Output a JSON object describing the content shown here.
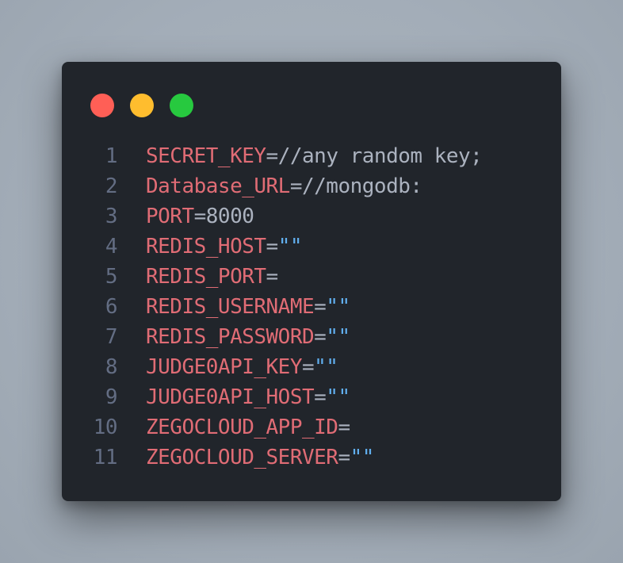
{
  "colors": {
    "close": "#ff5f56",
    "minimize": "#ffbd2e",
    "maximize": "#27c93f",
    "editor_bg": "#21252b",
    "key": "#e06c75",
    "text": "#abb2bf",
    "string": "#61afef",
    "line_number": "#636d83"
  },
  "window_controls": [
    "close-dot",
    "minimize-dot",
    "maximize-dot"
  ],
  "lines": [
    {
      "num": "1",
      "key": "SECRET_KEY",
      "op": "=",
      "val": "//any random key;",
      "str": ""
    },
    {
      "num": "2",
      "key": "Database_URL",
      "op": "=",
      "val": "//mongodb:",
      "str": ""
    },
    {
      "num": "3",
      "key": "PORT",
      "op": "=",
      "val": "8000",
      "str": ""
    },
    {
      "num": "4",
      "key": "REDIS_HOST",
      "op": "=",
      "val": "",
      "str": "\"\""
    },
    {
      "num": "5",
      "key": "REDIS_PORT",
      "op": "=",
      "val": "",
      "str": ""
    },
    {
      "num": "6",
      "key": "REDIS_USERNAME",
      "op": "=",
      "val": "",
      "str": "\"\""
    },
    {
      "num": "7",
      "key": "REDIS_PASSWORD",
      "op": "=",
      "val": "",
      "str": "\"\""
    },
    {
      "num": "8",
      "key": "JUDGE0API_KEY",
      "op": "=",
      "val": "",
      "str": "\"\""
    },
    {
      "num": "9",
      "key": "JUDGE0API_HOST",
      "op": "=",
      "val": "",
      "str": "\"\""
    },
    {
      "num": "10",
      "key": "ZEGOCLOUD_APP_ID",
      "op": "=",
      "val": "",
      "str": ""
    },
    {
      "num": "11",
      "key": "ZEGOCLOUD_SERVER",
      "op": "=",
      "val": "",
      "str": "\"\""
    }
  ]
}
